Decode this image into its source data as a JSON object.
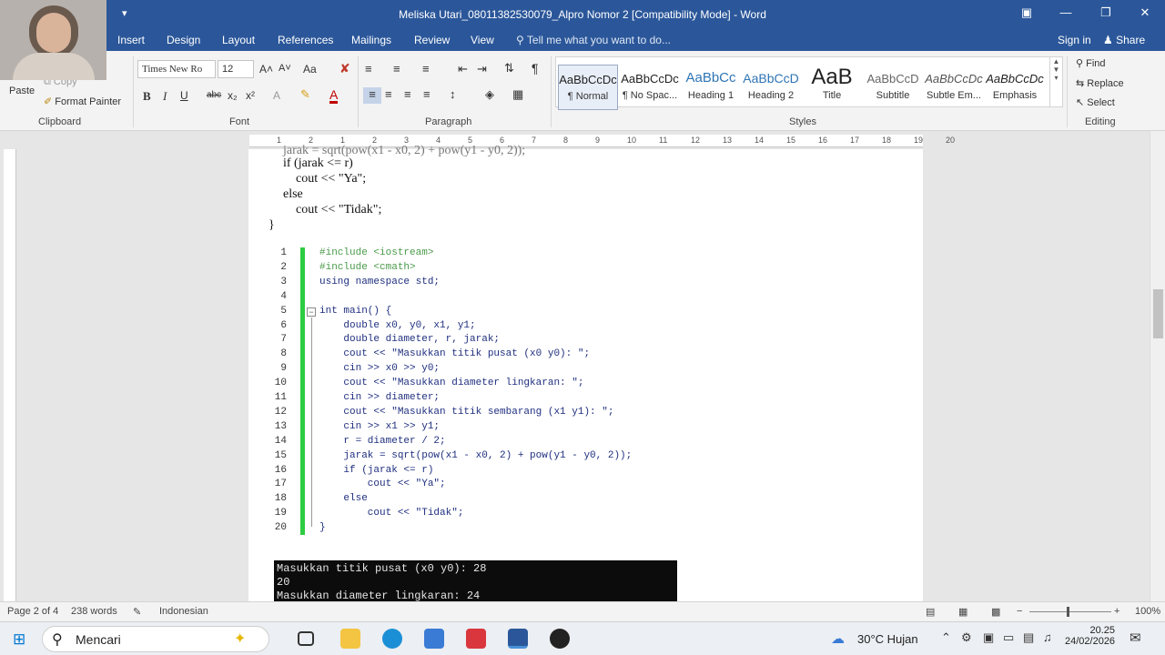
{
  "window": {
    "title": "Meliska Utari_08011382530079_Alpro Nomor 2 [Compatibility Mode] - Word",
    "qat_label": "▾",
    "minimize": "—",
    "restore": "❐",
    "close": "✕",
    "ribbon_display": "▣"
  },
  "tabs": {
    "items": [
      "Insert",
      "Design",
      "Layout",
      "References",
      "Mailings",
      "Review",
      "View"
    ],
    "tell_me": "Tell me what you want to do...",
    "sign_in": "Sign in",
    "share": "Share"
  },
  "clipboard": {
    "paste": "Paste",
    "copy": "Copy",
    "format_painter": "Format Painter",
    "label": "Clipboard"
  },
  "font": {
    "family": "Times New Ro",
    "size": "12",
    "grow": "A˄",
    "shrink": "A˅",
    "case": "Aa",
    "bold": "B",
    "italic": "I",
    "underline": "U",
    "strike": "abc",
    "subscript": "x₂",
    "superscript": "x²",
    "font_color": "A",
    "label": "Font"
  },
  "paragraph": {
    "label": "Paragraph",
    "pilcrow": "¶"
  },
  "styles": {
    "label": "Styles",
    "items": [
      {
        "preview": "AaBbCcDc",
        "name": "¶ Normal"
      },
      {
        "preview": "AaBbCcDc",
        "name": "¶ No Spac..."
      },
      {
        "preview": "AaBbCc",
        "name": "Heading 1"
      },
      {
        "preview": "AaBbCcD",
        "name": "Heading 2"
      },
      {
        "preview": "AaB",
        "name": "Title"
      },
      {
        "preview": "AaBbCcD",
        "name": "Subtitle"
      },
      {
        "preview": "AaBbCcDc",
        "name": "Subtle Em..."
      },
      {
        "preview": "AaBbCcDc",
        "name": "Emphasis"
      }
    ]
  },
  "editing": {
    "find": "Find",
    "replace": "Replace",
    "select": "Select",
    "label": "Editing"
  },
  "ruler": {
    "ticks": [
      "1",
      "2",
      "1",
      "2",
      "3",
      "4",
      "5",
      "6",
      "7",
      "8",
      "9",
      "10",
      "11",
      "12",
      "13",
      "14",
      "15",
      "16",
      "17",
      "18",
      "19",
      "20"
    ]
  },
  "document": {
    "top_lines": [
      "    jarak = sqrt(pow(x1 - x0, 2) + pow(y1 - y0, 2));",
      "    if (jarak <= r)",
      "        cout << \"Ya\";",
      "    else",
      "        cout << \"Tidak\";",
      "}"
    ],
    "code": [
      {
        "n": "1",
        "t": "#include <iostream>",
        "c": "#4a9a4a"
      },
      {
        "n": "2",
        "t": "#include <cmath>",
        "c": "#4a9a4a"
      },
      {
        "n": "3",
        "t": "using namespace std;",
        "c": "#1f2f7f"
      },
      {
        "n": "4",
        "t": "",
        "c": "#1f2f7f"
      },
      {
        "n": "5",
        "t": "int main() {",
        "c": "#1f2f7f"
      },
      {
        "n": "6",
        "t": "    double x0, y0, x1, y1;",
        "c": "#1f2f7f"
      },
      {
        "n": "7",
        "t": "    double diameter, r, jarak;",
        "c": "#1f2f7f"
      },
      {
        "n": "8",
        "t": "    cout << \"Masukkan titik pusat (x0 y0): \";",
        "c": "#1f2f7f"
      },
      {
        "n": "9",
        "t": "    cin >> x0 >> y0;",
        "c": "#1f2f7f"
      },
      {
        "n": "10",
        "t": "    cout << \"Masukkan diameter lingkaran: \";",
        "c": "#1f2f7f"
      },
      {
        "n": "11",
        "t": "    cin >> diameter;",
        "c": "#1f2f7f"
      },
      {
        "n": "12",
        "t": "    cout << \"Masukkan titik sembarang (x1 y1): \";",
        "c": "#1f2f7f"
      },
      {
        "n": "13",
        "t": "    cin >> x1 >> y1;",
        "c": "#1f2f7f"
      },
      {
        "n": "14",
        "t": "    r = diameter / 2;",
        "c": "#1f2f7f"
      },
      {
        "n": "15",
        "t": "    jarak = sqrt(pow(x1 - x0, 2) + pow(y1 - y0, 2));",
        "c": "#1f2f7f"
      },
      {
        "n": "16",
        "t": "    if (jarak <= r)",
        "c": "#1f2f7f"
      },
      {
        "n": "17",
        "t": "        cout << \"Ya\";",
        "c": "#1f2f7f"
      },
      {
        "n": "18",
        "t": "    else",
        "c": "#1f2f7f"
      },
      {
        "n": "19",
        "t": "        cout << \"Tidak\";",
        "c": "#1f2f7f"
      },
      {
        "n": "20",
        "t": "}",
        "c": "#1f2f7f"
      }
    ],
    "console": [
      "Masukkan titik pusat (x0 y0): 28",
      "20",
      "Masukkan diameter lingkaran: 24"
    ]
  },
  "status": {
    "page": "Page 2 of 4",
    "words": "238 words",
    "language": "Indonesian",
    "zoom": "100%"
  },
  "taskbar": {
    "search": "Mencari",
    "weather": "30°C  Hujan",
    "time": "20.25",
    "date": "24/02/2026"
  },
  "colors": {
    "word_blue": "#2b579a",
    "change_bar": "#2ecc40"
  }
}
